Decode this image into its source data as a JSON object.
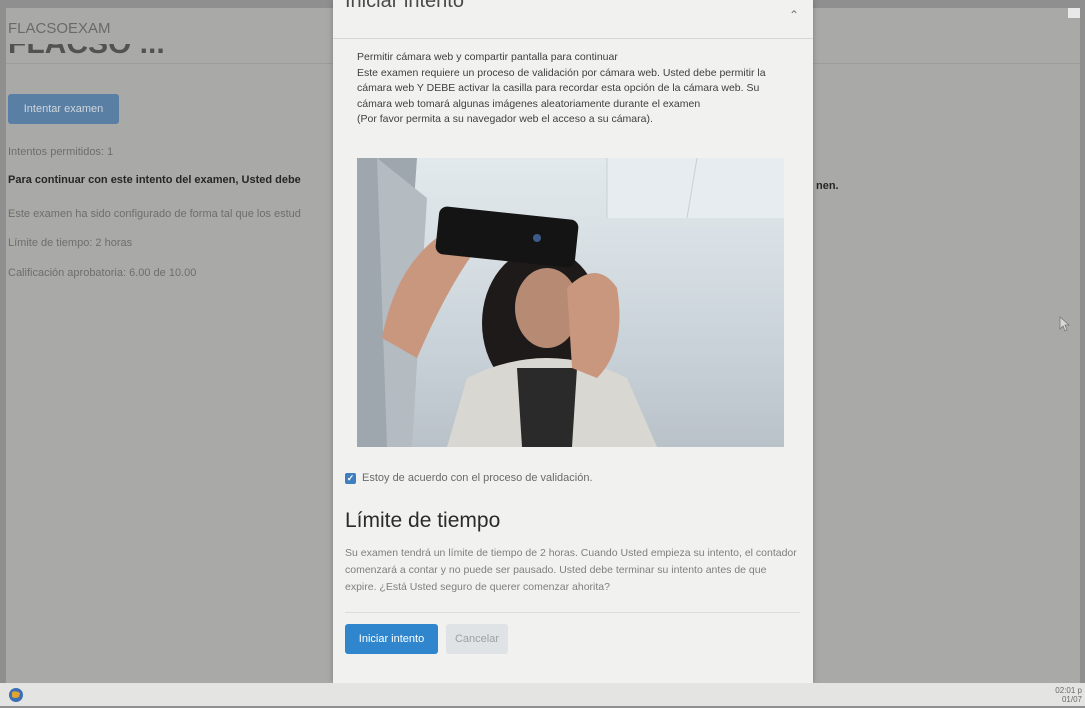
{
  "background_page": {
    "brand": "FLACSOEXAM",
    "heading_partial": "FLACSO ...",
    "attempt_button_label": "Intentar examen",
    "attempts_allowed": "Intentos permitidos: 1",
    "continue_notice": "Para continuar con este intento del examen, Usted debe",
    "continue_notice_end": "nen.",
    "configured_text": "Este examen ha sido configurado de forma tal que los estud",
    "time_limit": "Límite de tiempo: 2 horas",
    "passing_grade": "Calificación aprobatoria: 6.00 de 10.00"
  },
  "modal": {
    "title": "Iniciar intento",
    "intro_lines": [
      "Permitir cámara web y compartir pantalla para continuar",
      "Este examen requiere un proceso de validación por cámara web. Usted debe permitir la cámara web Y DEBE activar la casilla para recordar esta opción de la cámara web. Su cámara web tomará algunas imágenes aleatoriamente durante el examen",
      "(Por favor permita a su navegador web el acceso a su cámara)."
    ],
    "agree_label": "Estoy de acuerdo con el proceso de validación.",
    "section_title": "Límite de tiempo",
    "section_text": "Su examen tendrá un límite de tiempo de 2 horas. Cuando Usted empieza su intento, el contador comenzará a contar y no puede ser pausado. Usted debe terminar su intento antes de que expire. ¿Está Usted seguro de querer comenzar ahorita?",
    "start_button": "Iniciar intento",
    "cancel_button": "Cancelar"
  },
  "taskbar": {
    "clock_time": "02:01 p",
    "clock_date": "01/07"
  },
  "colors": {
    "primary": "#2f86cc",
    "checkbox": "#3f7fc0",
    "backdrop": "#a9a9a7"
  }
}
